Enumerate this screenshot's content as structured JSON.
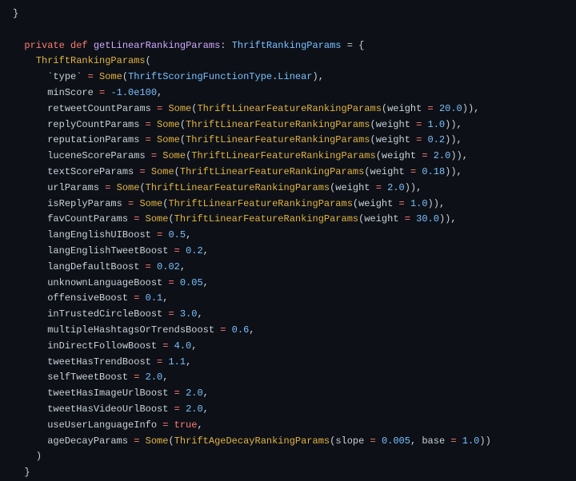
{
  "code": {
    "closeBrace0": "}",
    "blank": "",
    "sig": {
      "private": "private",
      "def": "def",
      "fnName": "getLinearRankingParams",
      "colon": ":",
      "retType": "ThriftRankingParams",
      "eqBrace": "= {"
    },
    "ctor": "ThriftRankingParams",
    "typeLine": {
      "name": "`type`",
      "some": "Some",
      "enumType": "ThriftScoringFunctionType",
      "enumVal": "Linear"
    },
    "minScore": {
      "name": "minScore",
      "val": "-1.0e100"
    },
    "params": [
      {
        "name": "retweetCountParams",
        "some": "Some",
        "cls": "ThriftLinearFeatureRankingParams",
        "wlabel": "weight",
        "wval": "20.0"
      },
      {
        "name": "replyCountParams",
        "some": "Some",
        "cls": "ThriftLinearFeatureRankingParams",
        "wlabel": "weight",
        "wval": "1.0"
      },
      {
        "name": "reputationParams",
        "some": "Some",
        "cls": "ThriftLinearFeatureRankingParams",
        "wlabel": "weight",
        "wval": "0.2"
      },
      {
        "name": "luceneScoreParams",
        "some": "Some",
        "cls": "ThriftLinearFeatureRankingParams",
        "wlabel": "weight",
        "wval": "2.0"
      },
      {
        "name": "textScoreParams",
        "some": "Some",
        "cls": "ThriftLinearFeatureRankingParams",
        "wlabel": "weight",
        "wval": "0.18"
      },
      {
        "name": "urlParams",
        "some": "Some",
        "cls": "ThriftLinearFeatureRankingParams",
        "wlabel": "weight",
        "wval": "2.0"
      },
      {
        "name": "isReplyParams",
        "some": "Some",
        "cls": "ThriftLinearFeatureRankingParams",
        "wlabel": "weight",
        "wval": "1.0"
      },
      {
        "name": "favCountParams",
        "some": "Some",
        "cls": "ThriftLinearFeatureRankingParams",
        "wlabel": "weight",
        "wval": "30.0"
      }
    ],
    "boosts": [
      {
        "name": "langEnglishUIBoost",
        "val": "0.5"
      },
      {
        "name": "langEnglishTweetBoost",
        "val": "0.2"
      },
      {
        "name": "langDefaultBoost",
        "val": "0.02"
      },
      {
        "name": "unknownLanguageBoost",
        "val": "0.05"
      },
      {
        "name": "offensiveBoost",
        "val": "0.1"
      },
      {
        "name": "inTrustedCircleBoost",
        "val": "3.0"
      },
      {
        "name": "multipleHashtagsOrTrendsBoost",
        "val": "0.6"
      },
      {
        "name": "inDirectFollowBoost",
        "val": "4.0"
      },
      {
        "name": "tweetHasTrendBoost",
        "val": "1.1"
      },
      {
        "name": "selfTweetBoost",
        "val": "2.0"
      },
      {
        "name": "tweetHasImageUrlBoost",
        "val": "2.0"
      },
      {
        "name": "tweetHasVideoUrlBoost",
        "val": "2.0"
      }
    ],
    "useUserLang": {
      "name": "useUserLanguageInfo",
      "val": "true"
    },
    "ageDecay": {
      "name": "ageDecayParams",
      "some": "Some",
      "cls": "ThriftAgeDecayRankingParams",
      "slopeLabel": "slope",
      "slopeVal": "0.005",
      "baseLabel": "base",
      "baseVal": "1.0"
    },
    "closeParen": ")",
    "closeBrace": "}"
  }
}
